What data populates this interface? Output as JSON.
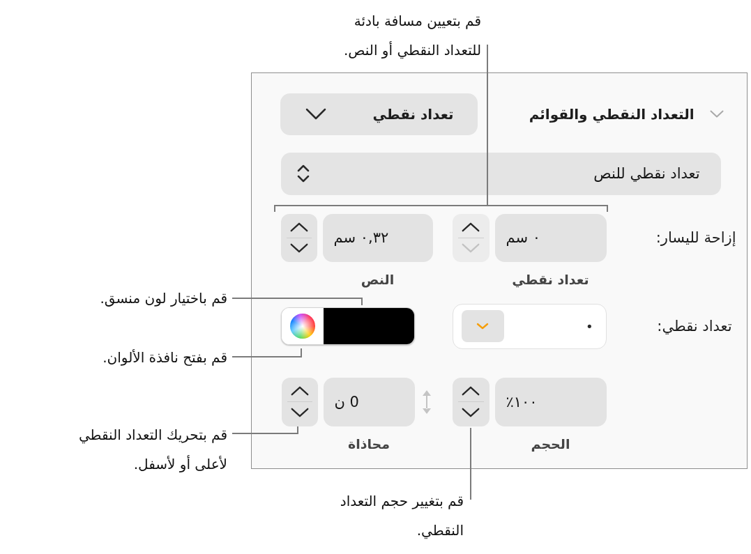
{
  "callouts": [
    {
      "text": "قم بتعيين مسافة بادئة\nللتعداد النقطي أو النص."
    },
    {
      "text": "قم باختيار لون منسق."
    },
    {
      "text": "قم بفتح نافذة الألوان."
    },
    {
      "text": "قم بتحريك التعداد النقطي\nلأعلى أو لأسفل."
    },
    {
      "text": "قم بتغيير حجم التعداد\nالنقطي."
    }
  ],
  "panel": {
    "section": {
      "title": "التعداد النقطي والقوائم",
      "expanded": true
    },
    "list_style_popup": {
      "value": "تعداد نقطي"
    },
    "bullet_type_popup": {
      "value": "تعداد نقطي للنص"
    },
    "indent": {
      "label": "إزاحة لليسار:",
      "fields": [
        {
          "value": "٠ سم",
          "caption": "تعداد نقطي",
          "decrement_disabled": true
        },
        {
          "value": "٠,٣٢ سم",
          "caption": "النص",
          "decrement_disabled": false
        }
      ]
    },
    "bullet": {
      "label": "تعداد نقطي:",
      "value": "•",
      "color": "#000000"
    },
    "size_alignment": {
      "fields": [
        {
          "kind": "size",
          "value": "١٠٠٪",
          "caption": "الحجم",
          "decrement_disabled": false
        },
        {
          "kind": "alignment",
          "value": "0 ن",
          "caption": "محاذاة",
          "decrement_disabled": false
        }
      ]
    }
  }
}
